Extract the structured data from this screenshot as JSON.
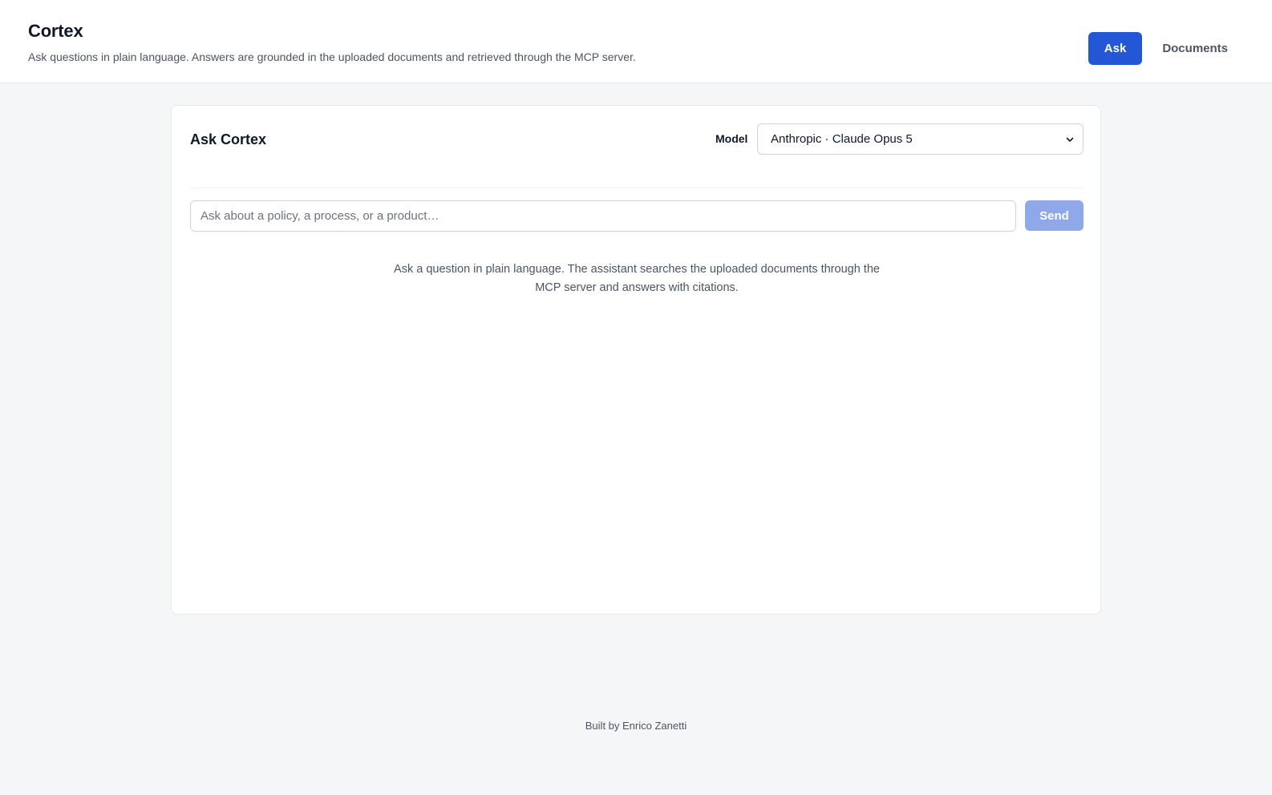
{
  "header": {
    "title": "Cortex",
    "subtitle": "Ask questions in plain language. Answers are grounded in the uploaded documents and retrieved through the MCP server.",
    "nav": [
      {
        "label": "Ask",
        "active": true
      },
      {
        "label": "Documents",
        "active": false
      }
    ]
  },
  "ask_card": {
    "title": "Ask Cortex",
    "model_label": "Model",
    "model_selected": "Anthropic · Claude Opus 5",
    "model_icon": "chevron-down-icon",
    "input_placeholder": "Ask about a policy, a process, or a product…",
    "input_value": "",
    "send_label": "Send",
    "empty_hint": "Ask a question in plain language. The assistant searches the uploaded documents through the MCP server and answers with citations."
  },
  "footer": {
    "text": "Built by Enrico Zanetti"
  },
  "colors": {
    "accent": "#2357d6",
    "send_disabled": "#8ea8ea",
    "background": "#f5f6f8"
  }
}
